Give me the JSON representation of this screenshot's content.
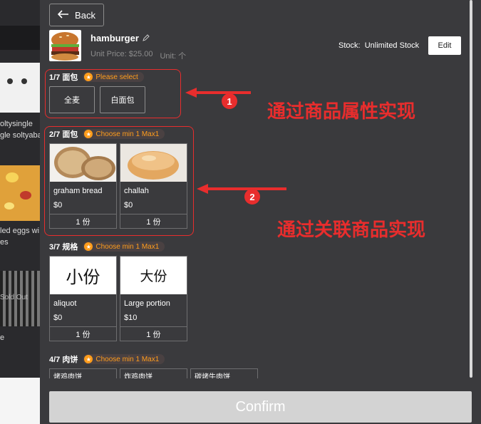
{
  "background_page": {
    "texts": [
      "oltysingle",
      "gle soltyaba",
      "led eggs wi",
      "es",
      "e"
    ],
    "sold_out": "Sold Out"
  },
  "header": {
    "back_label": "Back"
  },
  "product": {
    "name": "hamburger",
    "unit_price": "Unit Price: $25.00",
    "unit": "Unit: 个",
    "stock_label": "Stock:",
    "stock_value": "Unlimited Stock",
    "edit_label": "Edit"
  },
  "groups": [
    {
      "title": "1/7 面包",
      "badge": "Please select",
      "options": [
        "全麦",
        "白面包"
      ]
    },
    {
      "title": "2/7 面包",
      "badge": "Choose min 1 Max1",
      "items": [
        {
          "name": "graham bread",
          "price": "$0",
          "qty": "1 份"
        },
        {
          "name": "challah",
          "price": "$0",
          "qty": "1 份"
        }
      ]
    },
    {
      "title": "3/7 规格",
      "badge": "Choose min 1 Max1",
      "items": [
        {
          "image_text": "小份",
          "name": "aliquot",
          "price": "$0",
          "qty": "1 份"
        },
        {
          "image_text": "大份",
          "name": "Large portion",
          "price": "$10",
          "qty": "1 份"
        }
      ]
    },
    {
      "title": "4/7 肉饼",
      "badge": "Choose min 1 Max1",
      "items": [
        {
          "name": "烤鸡肉饼"
        },
        {
          "name": "炸鸡肉饼"
        },
        {
          "name": "碳烤牛肉饼"
        }
      ]
    }
  ],
  "annotations": [
    {
      "number": "1",
      "text": "通过商品属性实现"
    },
    {
      "number": "2",
      "text": "通过关联商品实现"
    }
  ],
  "footer": {
    "confirm_label": "Confirm"
  },
  "colors": {
    "accent_orange": "#ff9d1c",
    "annotation_red": "#e82d2d",
    "dialog_bg": "#3a3a3d"
  }
}
